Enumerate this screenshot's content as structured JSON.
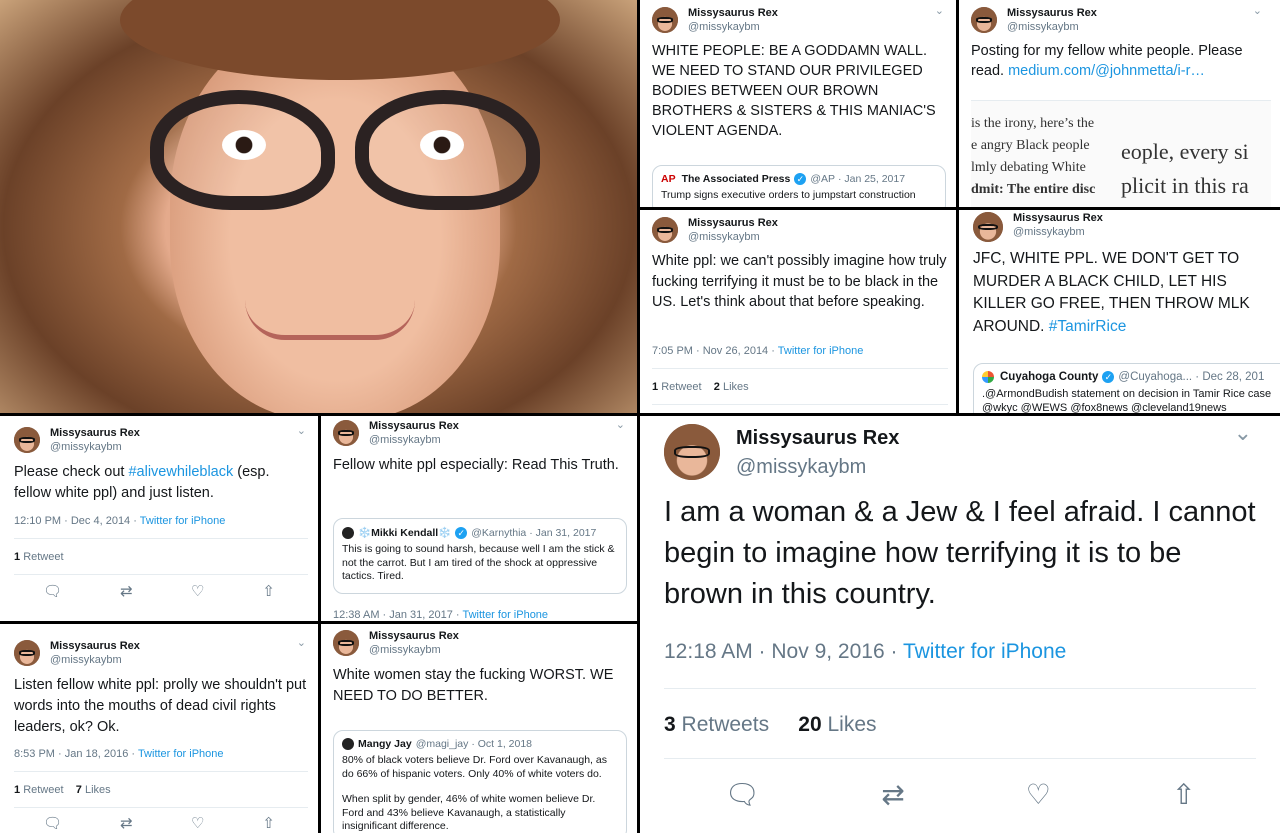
{
  "colors": {
    "link": "#1b95e0",
    "muted": "#657786",
    "verified": "#1da1f2"
  },
  "icons": {
    "chevron": "chevron-down-icon",
    "reply": "reply-icon",
    "retweet": "retweet-icon",
    "like": "heart-icon",
    "share": "share-icon",
    "verified": "verified-badge-icon"
  },
  "t1": {
    "name": "Missysaurus Rex",
    "handle": "@missykaybm",
    "text": "WHITE PEOPLE: BE A GODDAMN WALL. WE NEED TO STAND OUR PRIVILEGED BODIES BETWEEN OUR BROWN BROTHERS & SISTERS & THIS MANIAC'S VIOLENT AGENDA.",
    "quote": {
      "logo": "AP",
      "name": "The Associated Press",
      "handle": "@AP",
      "date": "· Jan 25, 2017",
      "text": "Trump signs executive orders to jumpstart construction"
    }
  },
  "t2": {
    "name": "Missysaurus Rex",
    "handle": "@missykaybm",
    "text": "Posting for my fellow white people. Please read.",
    "link": "medium.com/@johnmetta/i-r…",
    "article": [
      "is the irony, here’s the",
      "e angry Black people",
      "lmly debating White",
      "dmit: The entire disc"
    ],
    "article_right": [
      "eople, every si",
      "plicit in this ra"
    ]
  },
  "t3": {
    "name": "Missysaurus Rex",
    "handle": "@missykaybm",
    "text": "White ppl: we can't possibly imagine how truly fucking terrifying it must be to be black in the US. Let's think about that before speaking.",
    "time": "7:05 PM · Nov 26, 2014 ·",
    "client": "Twitter for iPhone",
    "retweets_n": "1",
    "retweets_l": "Retweet",
    "likes_n": "2",
    "likes_l": "Likes"
  },
  "t4": {
    "name": "Missysaurus Rex",
    "handle": "@missykaybm",
    "text": "JFC, WHITE PPL. WE DON'T GET TO MURDER A BLACK CHILD, LET HIS KILLER GO FREE, THEN THROW MLK AROUND.",
    "hashtag": "#TamirRice",
    "quote": {
      "name": "Cuyahoga County",
      "handle": "@Cuyahoga...",
      "date": "· Dec 28, 201",
      "text": ".@ArmondBudish statement on decision in Tamir Rice case @wkyc @WEWS @fox8news @cleveland19news"
    }
  },
  "t5": {
    "name": "Missysaurus Rex",
    "handle": "@missykaybm",
    "text_a": "Please check out",
    "hashtag": "#alivewhileblack",
    "text_b": "(esp. fellow white ppl) and just listen.",
    "time": "12:10 PM · Dec 4, 2014 ·",
    "client": "Twitter for iPhone",
    "retweets_n": "1",
    "retweets_l": "Retweet"
  },
  "t6": {
    "name": "Missysaurus Rex",
    "handle": "@missykaybm",
    "text": "Fellow white ppl especially: Read This Truth.",
    "quote": {
      "name": "❄️Mikki Kendall❄️",
      "handle": "@Karnythia",
      "date": "· Jan 31, 2017",
      "text": "This is going to sound harsh, because well I am the stick & not the carrot. But I am tired of the shock at oppressive tactics. Tired."
    },
    "time": "12:38 AM · Jan 31, 2017 ·",
    "client": "Twitter for iPhone"
  },
  "t7": {
    "name": "Missysaurus Rex",
    "handle": "@missykaybm",
    "text": "Listen fellow white ppl: prolly we shouldn't put words into the mouths of dead civil rights leaders, ok? Ok.",
    "time": "8:53 PM · Jan 18, 2016 ·",
    "client": "Twitter for iPhone",
    "retweets_n": "1",
    "retweets_l": "Retweet",
    "likes_n": "7",
    "likes_l": "Likes"
  },
  "t8": {
    "name": "Missysaurus Rex",
    "handle": "@missykaybm",
    "text": "White women stay the fucking WORST. WE NEED TO DO BETTER.",
    "quote": {
      "name": "Mangy Jay",
      "handle": "@magi_jay",
      "date": "· Oct 1, 2018",
      "text1": "80% of black voters believe Dr. Ford over Kavanaugh, as do 66% of hispanic voters. Only 40% of white voters do.",
      "text2": "When split by gender, 46% of white women believe Dr. Ford and 43% believe Kavanaugh, a statistically insignificant difference."
    }
  },
  "t9": {
    "name": "Missysaurus Rex",
    "handle": "@missykaybm",
    "text": "I am a woman & a Jew & I feel afraid. I cannot begin to imagine how terrifying it is to be brown in this country.",
    "time": "12:18 AM · Nov 9, 2016 ·",
    "client": "Twitter for iPhone",
    "retweets_n": "3",
    "retweets_l": "Retweets",
    "likes_n": "20",
    "likes_l": "Likes"
  }
}
